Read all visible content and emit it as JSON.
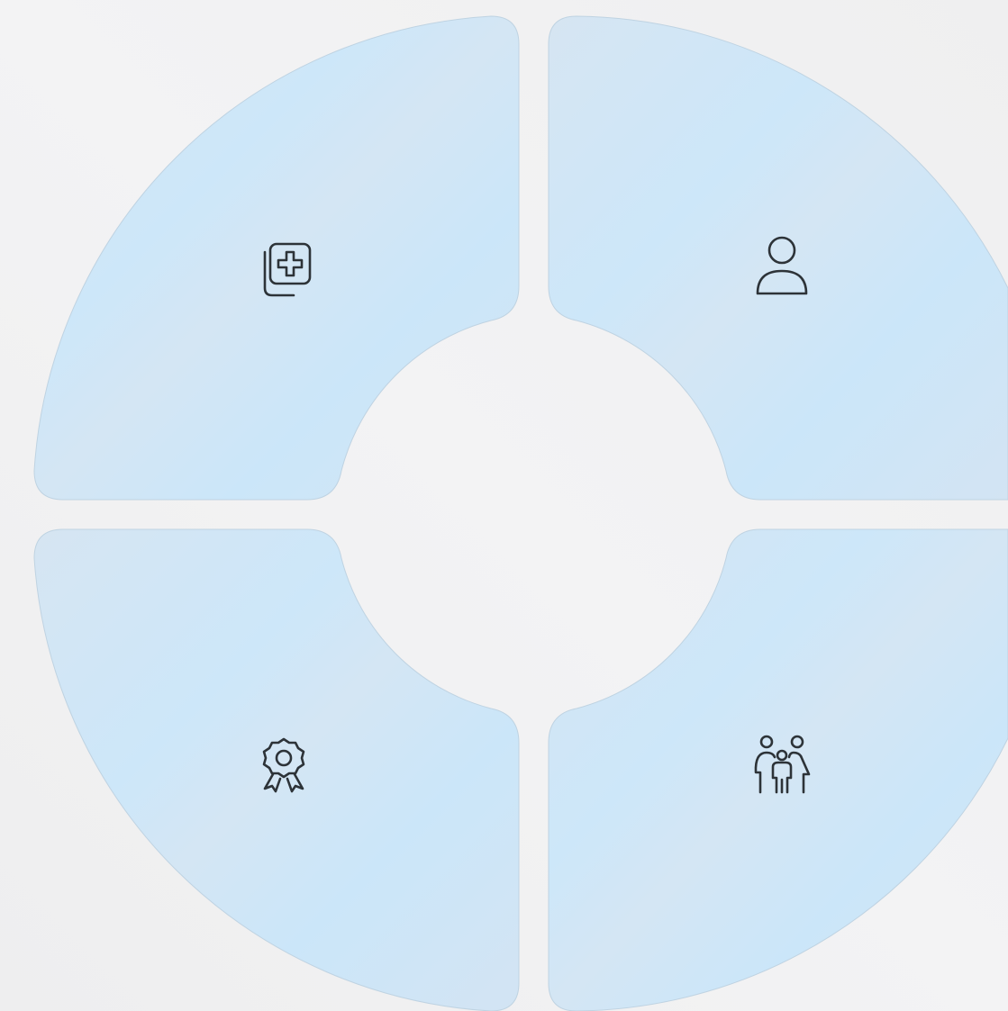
{
  "background_color": "#f1f1f2",
  "segment_fill_light": "#cde7f9",
  "segment_fill_dark": "#d6e5f2",
  "icon_color": "#2d3338",
  "segments": [
    {
      "id": "top-left",
      "icon": "medical-records-icon"
    },
    {
      "id": "top-right",
      "icon": "person-icon"
    },
    {
      "id": "bottom-left",
      "icon": "award-badge-icon"
    },
    {
      "id": "bottom-right",
      "icon": "family-icon"
    }
  ]
}
